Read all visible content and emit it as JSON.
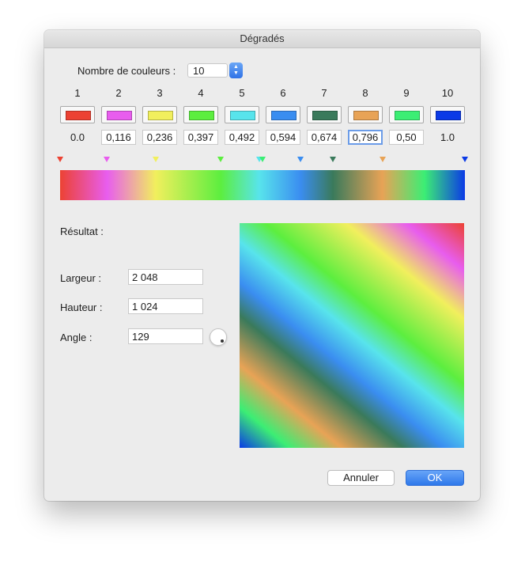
{
  "dialog": {
    "title": "Dégradés"
  },
  "count": {
    "label": "Nombre de couleurs :",
    "value": "10",
    "stepper_icon": "up-down-arrows-icon"
  },
  "stops": [
    {
      "index": "1",
      "position": "0.0",
      "color": "#ec4233",
      "editable": false
    },
    {
      "index": "2",
      "position": "0,116",
      "color": "#e85dee",
      "editable": true
    },
    {
      "index": "3",
      "position": "0,236",
      "color": "#f1ef5d",
      "editable": true
    },
    {
      "index": "4",
      "position": "0,397",
      "color": "#5cee3f",
      "editable": true
    },
    {
      "index": "5",
      "position": "0,492",
      "color": "#58e4ec",
      "editable": true
    },
    {
      "index": "6",
      "position": "0,594",
      "color": "#3a8df0",
      "editable": true
    },
    {
      "index": "7",
      "position": "0,674",
      "color": "#3a7a5b",
      "editable": true
    },
    {
      "index": "8",
      "position": "0,796",
      "color": "#e8a356",
      "editable": true,
      "focused": true
    },
    {
      "index": "9",
      "position": "0,50",
      "color": "#3cee74",
      "editable": true
    },
    {
      "index": "10",
      "position": "1.0",
      "color": "#0b3ae6",
      "editable": false
    }
  ],
  "result": {
    "label": "Résultat :"
  },
  "width": {
    "label": "Largeur :",
    "value": "2 048"
  },
  "height": {
    "label": "Hauteur :",
    "value": "1 024"
  },
  "angle": {
    "label": "Angle :",
    "value": "129",
    "dial_icon": "angle-dial-icon"
  },
  "buttons": {
    "cancel": "Annuler",
    "ok": "OK"
  },
  "colors": {
    "accent": "#2e78ea",
    "focus_ring": "#6b9ce8"
  }
}
